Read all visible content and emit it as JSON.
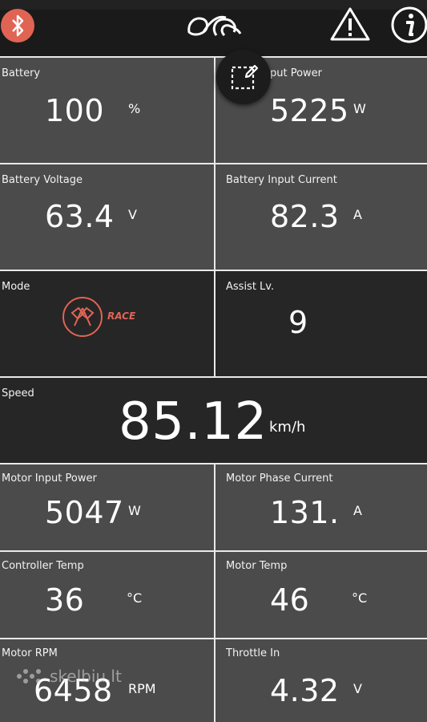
{
  "topbar": {
    "icons": {
      "bluetooth": "bluetooth-icon",
      "logo": "bike-logo-icon",
      "warning": "warning-icon",
      "info": "info-icon"
    },
    "colors": {
      "bluetooth_accent": "#e06454",
      "background": "#1a1a1a"
    }
  },
  "tiles": {
    "battery": {
      "label": "Battery",
      "value": "100",
      "unit": "%"
    },
    "battery_input_power": {
      "label": "put Power",
      "value": "5225",
      "unit": "W"
    },
    "battery_voltage": {
      "label": "Battery Voltage",
      "value": "63.4",
      "unit": "V"
    },
    "battery_input_current": {
      "label": "Battery Input Current",
      "value": "82.3",
      "unit": "A"
    },
    "mode": {
      "label": "Mode",
      "value": "RACE",
      "icon": "race-flags-icon",
      "accent": "#e06454"
    },
    "assist": {
      "label": "Assist Lv.",
      "value": "9"
    },
    "speed": {
      "label": "Speed",
      "value": "85.12",
      "unit": "km/h"
    },
    "motor_input_power": {
      "label": "Motor Input Power",
      "value": "5047",
      "unit": "W"
    },
    "motor_phase_current": {
      "label": "Motor Phase Current",
      "value": "131.",
      "unit": "A"
    },
    "controller_temp": {
      "label": "Controller Temp",
      "value": "36",
      "unit": "°C"
    },
    "motor_temp": {
      "label": "Motor Temp",
      "value": "46",
      "unit": "°C"
    },
    "motor_rpm": {
      "label": "Motor RPM",
      "value": "6458",
      "unit": "RPM"
    },
    "throttle_in": {
      "label": "Throttle In",
      "value": "4.32",
      "unit": "V"
    }
  },
  "overlay": {
    "fab_icon": "edit-layout-icon"
  },
  "watermark": {
    "text": "skelbiu.lt"
  }
}
